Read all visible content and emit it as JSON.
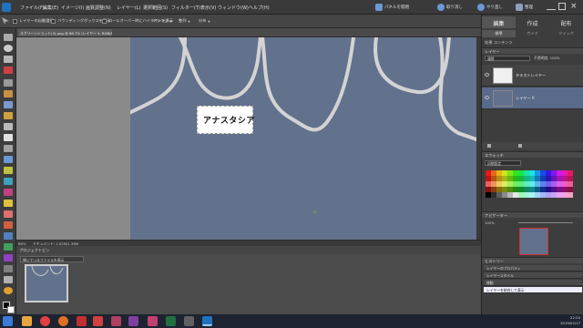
{
  "menu": {
    "items": [
      "ファイル(F)",
      "編集(E)",
      "イメージ(I)",
      "画質調整(N)",
      "レイヤー(L)",
      "選択範囲(S)",
      "フィルター(T)",
      "表示(V)",
      "ウィンドウ(W)",
      "ヘルプ(H)"
    ]
  },
  "top_right": {
    "open_label": "パネルを開閉",
    "undo_label": "取り消し",
    "redo_label": "やり直し",
    "organize_label": "整理"
  },
  "options": {
    "opt1": "レイヤーの自動選択",
    "opt2": "バウンディングボックスを表示",
    "opt3": "ロールオーバー時にハイライトを表示",
    "arrange_label": "アレンジ",
    "align_label": "整列",
    "distribute_label": "分布"
  },
  "doc": {
    "tab_title": "スクリーンショット(3).png @ 66.7% (レイヤー 0, RGB/8*)"
  },
  "canvas": {
    "text": "アナスタシア"
  },
  "status": {
    "zoom": "66%",
    "info": "ドキュメント: 1.02M/1.36M"
  },
  "bin": {
    "title": "プロジェクトビン",
    "select_value": "開いているファイルを表示"
  },
  "panel": {
    "tabs": [
      "編集",
      "作成",
      "配布"
    ],
    "subtabs": [
      "標準",
      "ガイド",
      "クイック"
    ],
    "effects_label": "効果",
    "content_label": "コンテンツ",
    "layers_title": "レイヤー",
    "blend_mode": "通常",
    "opacity_label": "不透明度: 100%",
    "layers": [
      {
        "name": "テキストレイヤー"
      },
      {
        "name": "レイヤー 0"
      }
    ],
    "swatches_title": "スウォッチ",
    "swatch_set": "初期設定",
    "navigator_title": "ナビゲーター",
    "nav_zoom": "100%",
    "history_title": "ヒストリー",
    "history": [
      {
        "label": "レイヤーのプロパティ"
      },
      {
        "label": "レイヤースタイル"
      },
      {
        "label": "移動"
      },
      {
        "label": "レイヤーを結合して表示"
      }
    ]
  },
  "colors": {
    "canvas": "#62718c",
    "accent": "#1e73be"
  },
  "taskbar": {
    "time": "22:20",
    "date": "2019/02/17"
  }
}
